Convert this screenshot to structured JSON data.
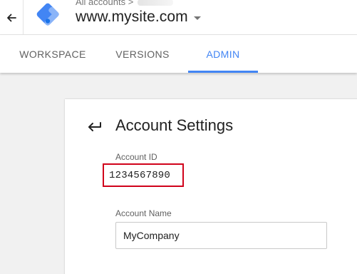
{
  "header": {
    "back_icon": "arrow-left-icon",
    "logo_icon": "tag-manager-logo-icon",
    "breadcrumb": "All accounts >",
    "container_name": "www.mysite.com",
    "caret_icon": "caret-down-icon"
  },
  "tabs": [
    {
      "label": "WORKSPACE",
      "active": false
    },
    {
      "label": "VERSIONS",
      "active": false
    },
    {
      "label": "ADMIN",
      "active": true
    }
  ],
  "settings": {
    "back_icon": "arrow-return-icon",
    "title": "Account Settings",
    "account_id_label": "Account ID",
    "account_id_value": "1234567890",
    "account_name_label": "Account Name",
    "account_name_value": "MyCompany"
  },
  "colors": {
    "accent": "#4285f4",
    "highlight": "#d0021b",
    "background": "#f1f1f1"
  }
}
